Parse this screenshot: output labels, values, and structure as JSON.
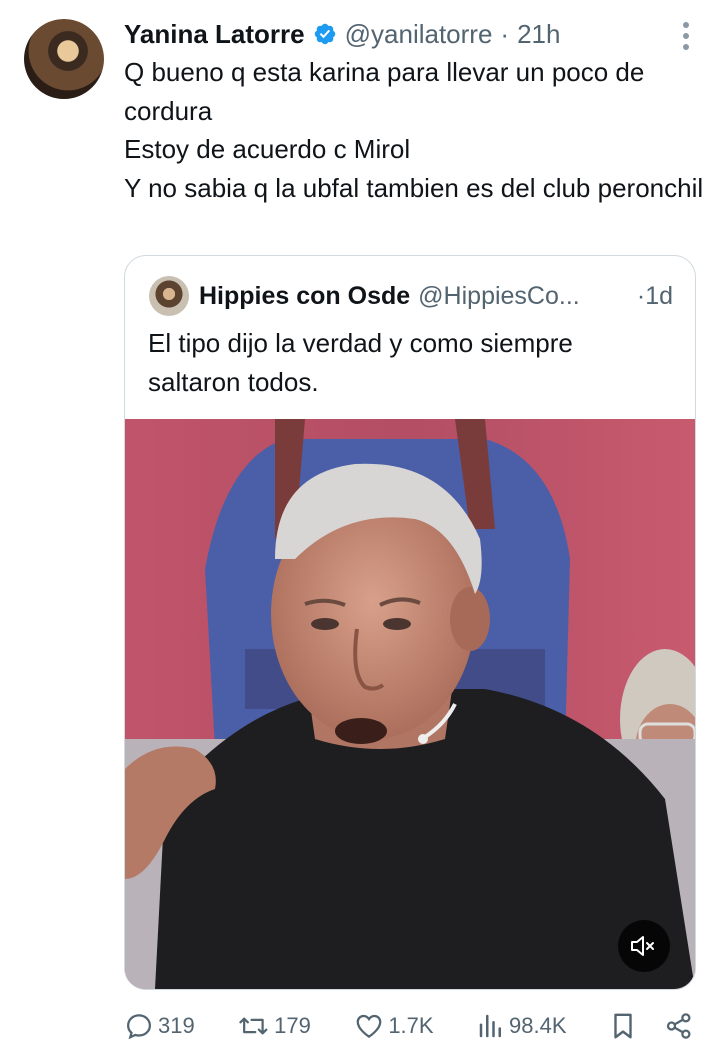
{
  "tweet": {
    "author_name": "Yanina Latorre",
    "author_handle": "@yanilatorre",
    "separator": "·",
    "time": "21h",
    "verified": true,
    "text_lines": [
      "Q bueno q esta karina para llevar un poco de cordura",
      "Estoy de acuerdo c Mirol",
      "Y no sabia q la ubfal tambien es del club peronchil"
    ]
  },
  "quote": {
    "author_name": "Hippies con Osde",
    "author_handle": "@HippiesCo...",
    "separator": "·",
    "time": "1d",
    "text": "El tipo dijo la verdad y como siempre saltaron todos.",
    "media": {
      "type": "video",
      "muted": true
    }
  },
  "actions": {
    "replies": "319",
    "reposts": "179",
    "likes": "1.7K",
    "views": "98.4K"
  },
  "icons": {
    "verified": "verified-badge-icon",
    "more": "more-options-icon",
    "reply": "reply-icon",
    "repost": "repost-icon",
    "like": "heart-icon",
    "views": "views-icon",
    "bookmark": "bookmark-icon",
    "share": "share-icon",
    "mute": "mute-icon"
  },
  "colors": {
    "text": "#0f1419",
    "secondary": "#536471",
    "verified": "#1d9bf0",
    "border": "#cfd9de"
  }
}
